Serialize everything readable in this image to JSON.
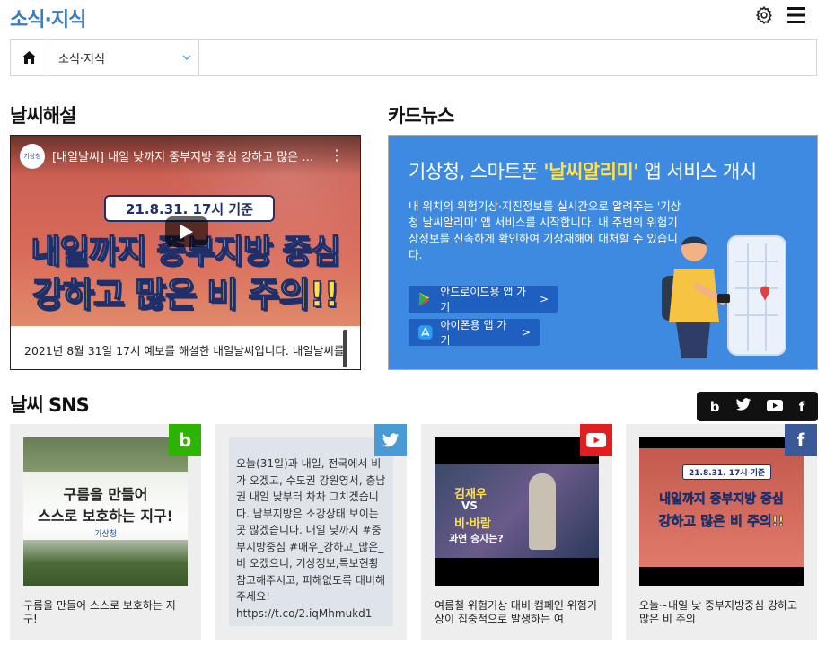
{
  "header": {
    "title": "소식·지식"
  },
  "breadcrumb": {
    "current": "소식·지식"
  },
  "sections": {
    "weather_commentary": "날씨해설",
    "card_news": "카드뉴스",
    "weather_sns": "날씨 SNS"
  },
  "video": {
    "channel_label": "기상청",
    "title": "[내일날씨] 내일 낮까지 중부지방 중심 강하고 많은 비 주의!!",
    "date_pill": "21.8.31. 17시 기준",
    "line1": "내일까지 중부지방 중심",
    "line2": "강하고 많은 비 주의!!",
    "caption": "2021년 8월 31일 17시 예보를 해설한 내일날씨입니다. 내일날씨를"
  },
  "card": {
    "title_prefix": "기상청, 스마트폰 ",
    "title_highlight": "'날씨알리미'",
    "title_suffix": " 앱 서비스 개시",
    "description": "내 위치의 위험기상·지진정보를 실시간으로 알려주는 '기상청 날씨알리미' 앱 서비스를 시작합니다. 내 주변의 위험기상정보를 신속하게 확인하여 기상재해에 대처할 수 있습니다.",
    "android_button": "안드로이드용 앱 가기",
    "ios_button": "아이폰용 앱 가기",
    "arrow": ">"
  },
  "sns_tabs": [
    "b",
    "t",
    "y",
    "f"
  ],
  "sns_cards": [
    {
      "badge": "b",
      "image_line1": "구름을 만들어",
      "image_line2": "스스로 보호하는 지구!",
      "image_logo": "기상청",
      "caption": "구름을 만들어 스스로 보호하는 지구!"
    },
    {
      "badge": "twitter",
      "text": "오늘(31일)과 내일, 전국에서 비가 오겠고, 수도권 강원영서, 충남권 내일 낮부터 차차 그치겠습니다. 남부지방은 소강상태 보이는 곳 많겠습니다. 내일 낮까지 #중부지방중심 #매우_강하고_많은_비 오겠으니, 기상정보,특보현황 참고해주시고, 피해없도록 대비해주세요! https://t.co/2.iqMhmukd1"
    },
    {
      "badge": "youtube",
      "image_line1": "김재우",
      "image_line2": "VS",
      "image_line3": "비·바람",
      "image_line4": "과연 승자는?",
      "caption": "여름철 위험기상 대비 캠페인 위험기상이 집중적으로 발생하는 여"
    },
    {
      "badge": "f",
      "image_date": "21.8.31. 17시 기준",
      "image_line1": "내일까지 중부지방 중심",
      "image_line2": "강하고 많은 비 주의!!",
      "caption": "오늘~내일 낮 중부지방중심 강하고 많은 비 주의"
    }
  ],
  "colors": {
    "title_blue": "#3a7cc0",
    "card_bg": "#3d8ae0",
    "blog_green": "#2db400",
    "twitter_blue": "#4a9ad4",
    "youtube_red": "#e02020",
    "facebook_blue": "#3b5998"
  }
}
